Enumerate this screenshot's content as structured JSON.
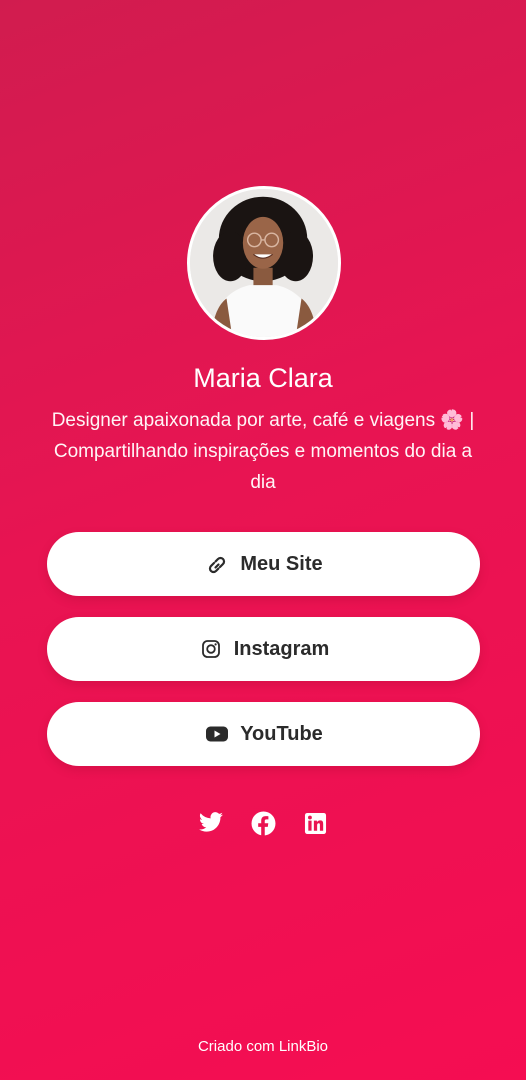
{
  "profile": {
    "name": "Maria Clara",
    "bio": "Designer apaixonada por arte, café e viagens 🌸 | Compartilhando inspirações e momentos do dia a dia"
  },
  "links": [
    {
      "label": "Meu Site",
      "icon": "link-icon"
    },
    {
      "label": "Instagram",
      "icon": "instagram-icon"
    },
    {
      "label": "YouTube",
      "icon": "youtube-icon"
    }
  ],
  "socials": [
    {
      "icon": "twitter-icon"
    },
    {
      "icon": "facebook-icon"
    },
    {
      "icon": "linkedin-icon"
    }
  ],
  "footer": {
    "text": "Criado com LinkBio"
  },
  "colors": {
    "background_top": "#d11c4f",
    "background_bottom": "#f50d52",
    "button_bg": "#ffffff",
    "button_text": "#2b2b2b"
  }
}
